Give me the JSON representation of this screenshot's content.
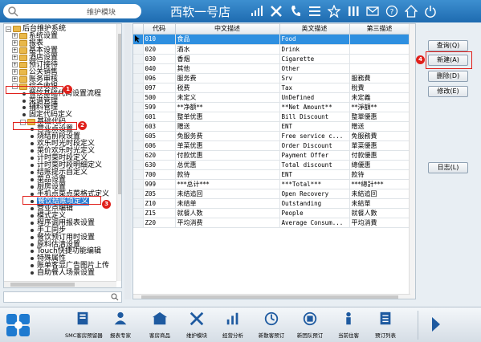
{
  "topbar": {
    "search_module_label": "维护模块",
    "brand": "西软一号店",
    "icons": [
      "signal-icon",
      "tools-icon",
      "phone-icon",
      "menu-icon",
      "star-icon",
      "columns-icon",
      "mail-icon",
      "help-icon",
      "home-icon",
      "power-icon"
    ]
  },
  "tree": {
    "items": [
      {
        "label": "后台维护系统",
        "level": 0,
        "kind": "folder",
        "expanded": true
      },
      {
        "label": "系统设置",
        "level": 1,
        "kind": "folder"
      },
      {
        "label": "报表",
        "level": 1,
        "kind": "folder"
      },
      {
        "label": "基本设置",
        "level": 1,
        "kind": "folder"
      },
      {
        "label": "酒店设置",
        "level": 1,
        "kind": "folder"
      },
      {
        "label": "预订接待",
        "level": 1,
        "kind": "folder"
      },
      {
        "label": "公关销售",
        "level": 1,
        "kind": "folder"
      },
      {
        "label": "账务审核",
        "level": 1,
        "kind": "folder"
      },
      {
        "label": "综合收银",
        "level": 1,
        "kind": "folder",
        "expanded": true
      },
      {
        "label": "餐饮基础代码设置流程",
        "level": 2,
        "kind": "leaf"
      },
      {
        "label": "菜谱管理",
        "level": 2,
        "kind": "leaf"
      },
      {
        "label": "辅料管理",
        "level": 2,
        "kind": "leaf"
      },
      {
        "label": "固定代码定义",
        "level": 2,
        "kind": "leaf"
      },
      {
        "label": "基础代码",
        "level": 2,
        "kind": "folder",
        "expanded": true
      },
      {
        "label": "营业点设置",
        "level": 3,
        "kind": "leaf"
      },
      {
        "label": "烧结前段设置",
        "level": 3,
        "kind": "leaf"
      },
      {
        "label": "欢乐时光时段定义",
        "level": 3,
        "kind": "leaf"
      },
      {
        "label": "菜价欢乐时光定义",
        "level": 3,
        "kind": "leaf"
      },
      {
        "label": "计时菜时段定义",
        "level": 3,
        "kind": "leaf"
      },
      {
        "label": "计时菜时段明细定义",
        "level": 3,
        "kind": "leaf"
      },
      {
        "label": "结账提示自定义",
        "level": 3,
        "kind": "leaf"
      },
      {
        "label": "菜品设置",
        "level": 3,
        "kind": "leaf"
      },
      {
        "label": "厨房设置",
        "level": 3,
        "kind": "leaf"
      },
      {
        "label": "手机点菜点菜格式定义",
        "level": 3,
        "kind": "leaf"
      },
      {
        "label": "餐饮结账项定义",
        "level": 3,
        "kind": "leaf",
        "selected": true
      },
      {
        "label": "营业点编辑",
        "level": 3,
        "kind": "leaf"
      },
      {
        "label": "模式定义",
        "level": 3,
        "kind": "leaf"
      },
      {
        "label": "程序调用报表设置",
        "level": 3,
        "kind": "leaf"
      },
      {
        "label": "手工同步",
        "level": 3,
        "kind": "leaf"
      },
      {
        "label": "餐饮预订用时设置",
        "level": 3,
        "kind": "leaf"
      },
      {
        "label": "原料估清设置",
        "level": 3,
        "kind": "leaf"
      },
      {
        "label": "Touch快捷功能编辑",
        "level": 3,
        "kind": "leaf"
      },
      {
        "label": "特殊属性",
        "level": 3,
        "kind": "leaf"
      },
      {
        "label": "账单客显广告图片上传",
        "level": 3,
        "kind": "leaf"
      },
      {
        "label": "自助餐人场景设置",
        "level": 3,
        "kind": "leaf"
      }
    ]
  },
  "grid": {
    "columns": [
      "代码",
      "中文描述",
      "英文描述",
      "第三描述"
    ],
    "rows": [
      [
        "010",
        "食品",
        "Food",
        ""
      ],
      [
        "020",
        "酒水",
        "Drink",
        ""
      ],
      [
        "030",
        "香烟",
        "Cigarette",
        ""
      ],
      [
        "040",
        "其他",
        "Other",
        ""
      ],
      [
        "096",
        "服务费",
        "Srv",
        "服務費"
      ],
      [
        "097",
        "税费",
        "Tax",
        "稅費"
      ],
      [
        "500",
        "未定义",
        "UnDefined",
        "未定義"
      ],
      [
        "599",
        "**净额**",
        "**Net Amount**",
        "**淨額**"
      ],
      [
        "601",
        "整单优惠",
        "Bill Discount",
        "整單優惠"
      ],
      [
        "603",
        "赠送",
        "ENT",
        "贈送"
      ],
      [
        "605",
        "免服务费",
        "Free service c...",
        "免服務費"
      ],
      [
        "606",
        "单菜优惠",
        "Order Discount",
        "單菜優惠"
      ],
      [
        "620",
        "付款优惠",
        "Payment Offer",
        "付款優惠"
      ],
      [
        "630",
        "总优惠",
        "Total discount",
        "總優惠"
      ],
      [
        "700",
        "款待",
        "ENT",
        "款待"
      ],
      [
        "999",
        "***总计***",
        "***Total***",
        "***總計***"
      ],
      [
        "Z05",
        "未结追回",
        "Open Recovery",
        "未結追回"
      ],
      [
        "Z10",
        "未结单",
        "Outstanding",
        "未結單"
      ],
      [
        "Z15",
        "就餐人数",
        "People",
        "就餐人數"
      ],
      [
        "Z20",
        "平均消费",
        "Average Consum...",
        "平均消費"
      ]
    ],
    "selected_row": 0
  },
  "buttons": {
    "query": "查询(Q)",
    "new": "新建(A)",
    "delete": "删除(D)",
    "modify": "修改(E)",
    "log": "日志(L)"
  },
  "annotations": [
    "1",
    "2",
    "3",
    "4"
  ],
  "toolbar": {
    "items": [
      {
        "label": "SMC客房预留器",
        "icon": "smc-icon"
      },
      {
        "label": "报表专家",
        "icon": "report-expert-icon"
      },
      {
        "label": "客房商品",
        "icon": "room-goods-icon"
      },
      {
        "label": "维护模块",
        "icon": "maintenance-icon"
      },
      {
        "label": "经营分析",
        "icon": "analysis-icon"
      },
      {
        "label": "新散客预订",
        "icon": "new-fit-booking-icon"
      },
      {
        "label": "新团队预订",
        "icon": "new-group-booking-icon"
      },
      {
        "label": "当前住客",
        "icon": "current-guest-icon"
      },
      {
        "label": "预订列表",
        "icon": "booking-list-icon"
      }
    ]
  },
  "colors": {
    "accent": "#1e6bb0",
    "selected": "#2e8fe0",
    "annotation": "#e0201b"
  }
}
